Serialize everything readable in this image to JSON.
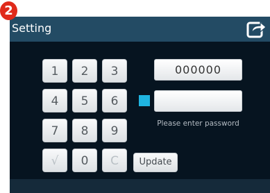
{
  "badge": "2",
  "header": {
    "title": "Setting",
    "export_icon": "export-icon"
  },
  "keypad": {
    "keys": [
      "1",
      "2",
      "3",
      "4",
      "5",
      "6",
      "7",
      "8",
      "9",
      "√",
      "0",
      "C"
    ]
  },
  "code_display": {
    "value": "000000"
  },
  "password": {
    "value": "",
    "hint": "Please enter password",
    "indicator_color": "#1fb4e0"
  },
  "update_label": "Update"
}
